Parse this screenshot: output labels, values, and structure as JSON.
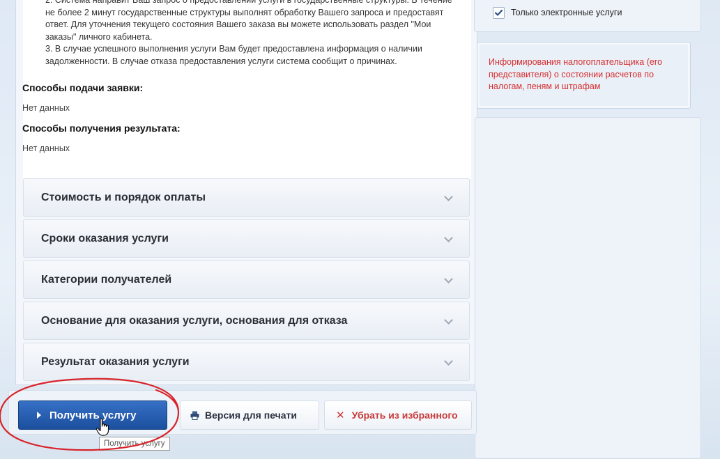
{
  "description": {
    "steps": [
      "2. Система направит Ваш запрос о предоставлении услуги в государственные структуры. В течение не более 2 минут государственные структуры выполнят обработку Вашего запроса и предоставят ответ. Для уточнения текущего состояния Вашего заказа вы можете использовать раздел \"Мои заказы\" личного кабинета.",
      "3. В случае успешного выполнения услуги Вам будет предоставлена информация о наличии задолженности. В случае отказа предоставления услуги система сообщит о причинах."
    ],
    "submission": {
      "title": "Способы подачи заявки:",
      "value": "Нет данных"
    },
    "result_methods": {
      "title": "Способы получения результата:",
      "value": "Нет данных"
    }
  },
  "accordion": [
    {
      "label": "Стоимость и порядок оплаты"
    },
    {
      "label": "Сроки оказания услуги"
    },
    {
      "label": "Категории получателей"
    },
    {
      "label": "Основание для оказания услуги, основания для отказа"
    },
    {
      "label": "Результат оказания услуги"
    }
  ],
  "sidebar": {
    "filter_label": "Только электронные услуги",
    "filter_checked": true,
    "info_text": "Информирования налогоплательщика (его представителя) о состоянии расчетов по налогам, пеням и штрафам"
  },
  "actions": {
    "get_service": "Получить услугу",
    "print_version": "Версия для печати",
    "remove_favorite": "Убрать из избранного",
    "tooltip": "Получить услугу"
  },
  "colors": {
    "primary": "#1c4f9e",
    "alert_text": "#d62e2e",
    "annotation": "#d8232a"
  }
}
